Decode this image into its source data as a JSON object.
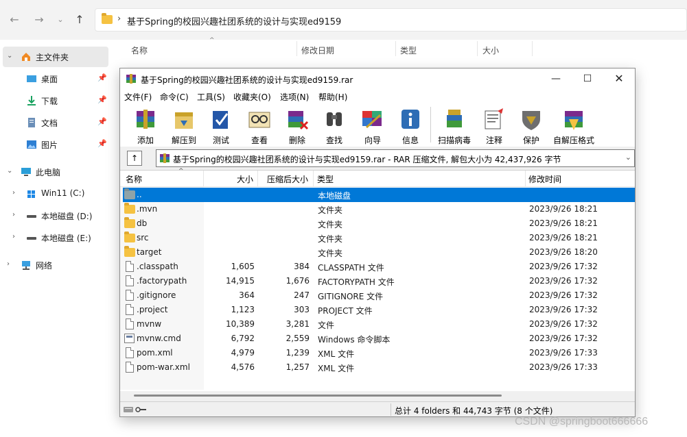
{
  "explorer": {
    "address_path": "基于Spring的校园兴趣社团系统的设计与实现ed9159",
    "column_headers": [
      "名称",
      "修改日期",
      "类型",
      "大小"
    ],
    "sidebar": [
      {
        "label": "主文件夹",
        "icon": "home-icon"
      },
      {
        "label": "桌面",
        "icon": "desktop-icon",
        "pinned": true
      },
      {
        "label": "下载",
        "icon": "download-icon",
        "pinned": true
      },
      {
        "label": "文档",
        "icon": "document-icon",
        "pinned": true
      },
      {
        "label": "图片",
        "icon": "picture-icon",
        "pinned": true
      },
      {
        "label": "此电脑",
        "icon": "computer-icon"
      },
      {
        "label": "Win11 (C:)",
        "icon": "windows-drive-icon"
      },
      {
        "label": "本地磁盘 (D:)",
        "icon": "drive-icon"
      },
      {
        "label": "本地磁盘 (E:)",
        "icon": "drive-icon"
      },
      {
        "label": "网络",
        "icon": "network-icon"
      }
    ]
  },
  "winrar": {
    "title": "基于Spring的校园兴趣社团系统的设计与实现ed9159.rar",
    "menu": [
      "文件(F)",
      "命令(C)",
      "工具(S)",
      "收藏夹(O)",
      "选项(N)",
      "帮助(H)"
    ],
    "toolbar": [
      {
        "label": "添加",
        "icon": "add-icon"
      },
      {
        "label": "解压到",
        "icon": "extract-to-icon"
      },
      {
        "label": "测试",
        "icon": "test-icon"
      },
      {
        "label": "查看",
        "icon": "view-icon"
      },
      {
        "label": "删除",
        "icon": "delete-icon"
      },
      {
        "label": "查找",
        "icon": "find-icon"
      },
      {
        "label": "向导",
        "icon": "wizard-icon"
      },
      {
        "label": "信息",
        "icon": "info-icon"
      },
      {
        "label": "扫描病毒",
        "icon": "virus-scan-icon"
      },
      {
        "label": "注释",
        "icon": "comment-icon"
      },
      {
        "label": "保护",
        "icon": "protect-icon"
      },
      {
        "label": "自解压格式",
        "icon": "sfx-icon"
      }
    ],
    "path_text": "基于Spring的校园兴趣社团系统的设计与实现ed9159.rar - RAR 压缩文件, 解包大小为 42,437,926 字节",
    "up_label": "↑",
    "columns": [
      "名称",
      "大小",
      "压缩后大小",
      "类型",
      "修改时间"
    ],
    "rows": [
      {
        "name": "..",
        "size": "",
        "packed": "",
        "type": "本地磁盘",
        "modified": "",
        "kind": "parent"
      },
      {
        "name": ".mvn",
        "size": "",
        "packed": "",
        "type": "文件夹",
        "modified": "2023/9/26 18:21",
        "kind": "folder"
      },
      {
        "name": "db",
        "size": "",
        "packed": "",
        "type": "文件夹",
        "modified": "2023/9/26 18:21",
        "kind": "folder"
      },
      {
        "name": "src",
        "size": "",
        "packed": "",
        "type": "文件夹",
        "modified": "2023/9/26 18:21",
        "kind": "folder"
      },
      {
        "name": "target",
        "size": "",
        "packed": "",
        "type": "文件夹",
        "modified": "2023/9/26 18:20",
        "kind": "folder"
      },
      {
        "name": ".classpath",
        "size": "1,605",
        "packed": "384",
        "type": "CLASSPATH 文件",
        "modified": "2023/9/26 17:32",
        "kind": "file"
      },
      {
        "name": ".factorypath",
        "size": "14,915",
        "packed": "1,676",
        "type": "FACTORYPATH 文件",
        "modified": "2023/9/26 17:32",
        "kind": "file"
      },
      {
        "name": ".gitignore",
        "size": "364",
        "packed": "247",
        "type": "GITIGNORE 文件",
        "modified": "2023/9/26 17:32",
        "kind": "file"
      },
      {
        "name": ".project",
        "size": "1,123",
        "packed": "303",
        "type": "PROJECT 文件",
        "modified": "2023/9/26 17:32",
        "kind": "file"
      },
      {
        "name": "mvnw",
        "size": "10,389",
        "packed": "3,281",
        "type": "文件",
        "modified": "2023/9/26 17:32",
        "kind": "file"
      },
      {
        "name": "mvnw.cmd",
        "size": "6,792",
        "packed": "2,559",
        "type": "Windows 命令脚本",
        "modified": "2023/9/26 17:32",
        "kind": "cmd"
      },
      {
        "name": "pom.xml",
        "size": "4,979",
        "packed": "1,239",
        "type": "XML 文件",
        "modified": "2023/9/26 17:33",
        "kind": "file"
      },
      {
        "name": "pom-war.xml",
        "size": "4,576",
        "packed": "1,257",
        "type": "XML 文件",
        "modified": "2023/9/26 17:33",
        "kind": "file"
      }
    ],
    "status": "总计 4 folders 和 44,743 字节 (8 个文件)"
  },
  "watermark": "CSDN @springboot666666",
  "colors": {
    "selection": "#0078d7",
    "folder": "#f5c242"
  }
}
